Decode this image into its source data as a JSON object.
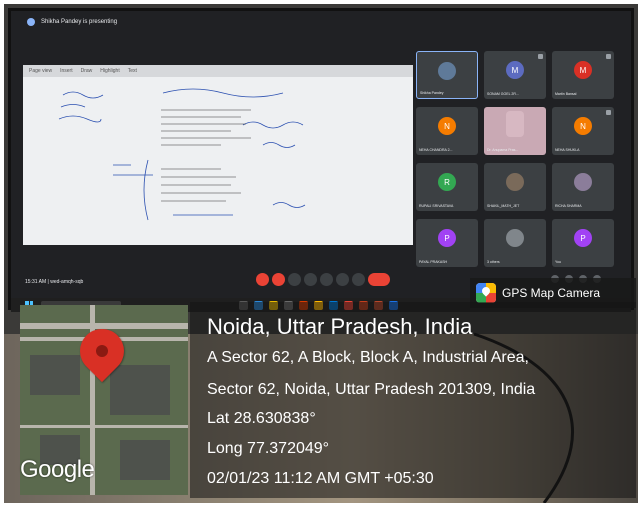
{
  "meet": {
    "presenter_banner": "Shikha Pandey is presenting",
    "meeting_info": "15:31 AM  |  wed-amqh-sqb",
    "participants": [
      {
        "name": "Shikha Pandey",
        "initial": "",
        "color": "#5f7a99",
        "active": true
      },
      {
        "name": "SONAM GOEL 2R...",
        "initial": "M",
        "color": "#5c6bc0",
        "active": false
      },
      {
        "name": "Martin Bansal",
        "initial": "M",
        "color": "#d93025",
        "active": false
      },
      {
        "name": "NEHA CHANDRA 2...",
        "initial": "N",
        "color": "#f57c00",
        "active": false
      },
      {
        "name": "Dr. Anupama Pras...",
        "initial": "",
        "color": "#c9a9b4",
        "active": false
      },
      {
        "name": "NEHA SHUKLA",
        "initial": "N",
        "color": "#f57c00",
        "active": false
      },
      {
        "name": "RUPALI SRIVASTAVA",
        "initial": "R",
        "color": "#33a852",
        "active": false
      },
      {
        "name": "SHAKIL_MATH_JET",
        "initial": "",
        "color": "#7a6a5a",
        "active": false
      },
      {
        "name": "RICHA SHARMA",
        "initial": "",
        "color": "#8b7d9a",
        "active": false
      },
      {
        "name": "PAYAL PRAKASH",
        "initial": "P",
        "color": "#a142f4",
        "active": false
      },
      {
        "name": "3 others",
        "initial": "",
        "color": "#80868b",
        "active": false
      },
      {
        "name": "You",
        "initial": "P",
        "color": "#a142f4",
        "active": false
      }
    ],
    "slide_tabs": [
      "Page view",
      "Insert",
      "Draw",
      "Highlight",
      "Text"
    ]
  },
  "gps": {
    "label": "GPS Map Camera",
    "city": "Noida, Uttar Pradesh, India",
    "address_line1": "A Sector 62, A Block, Block A, Industrial Area,",
    "address_line2": "Sector 62, Noida, Uttar Pradesh 201309, India",
    "lat": "Lat 28.630838°",
    "long": "Long 77.372049°",
    "datetime": "02/01/23 11:12 AM GMT +05:30",
    "map_brand": "Google"
  }
}
